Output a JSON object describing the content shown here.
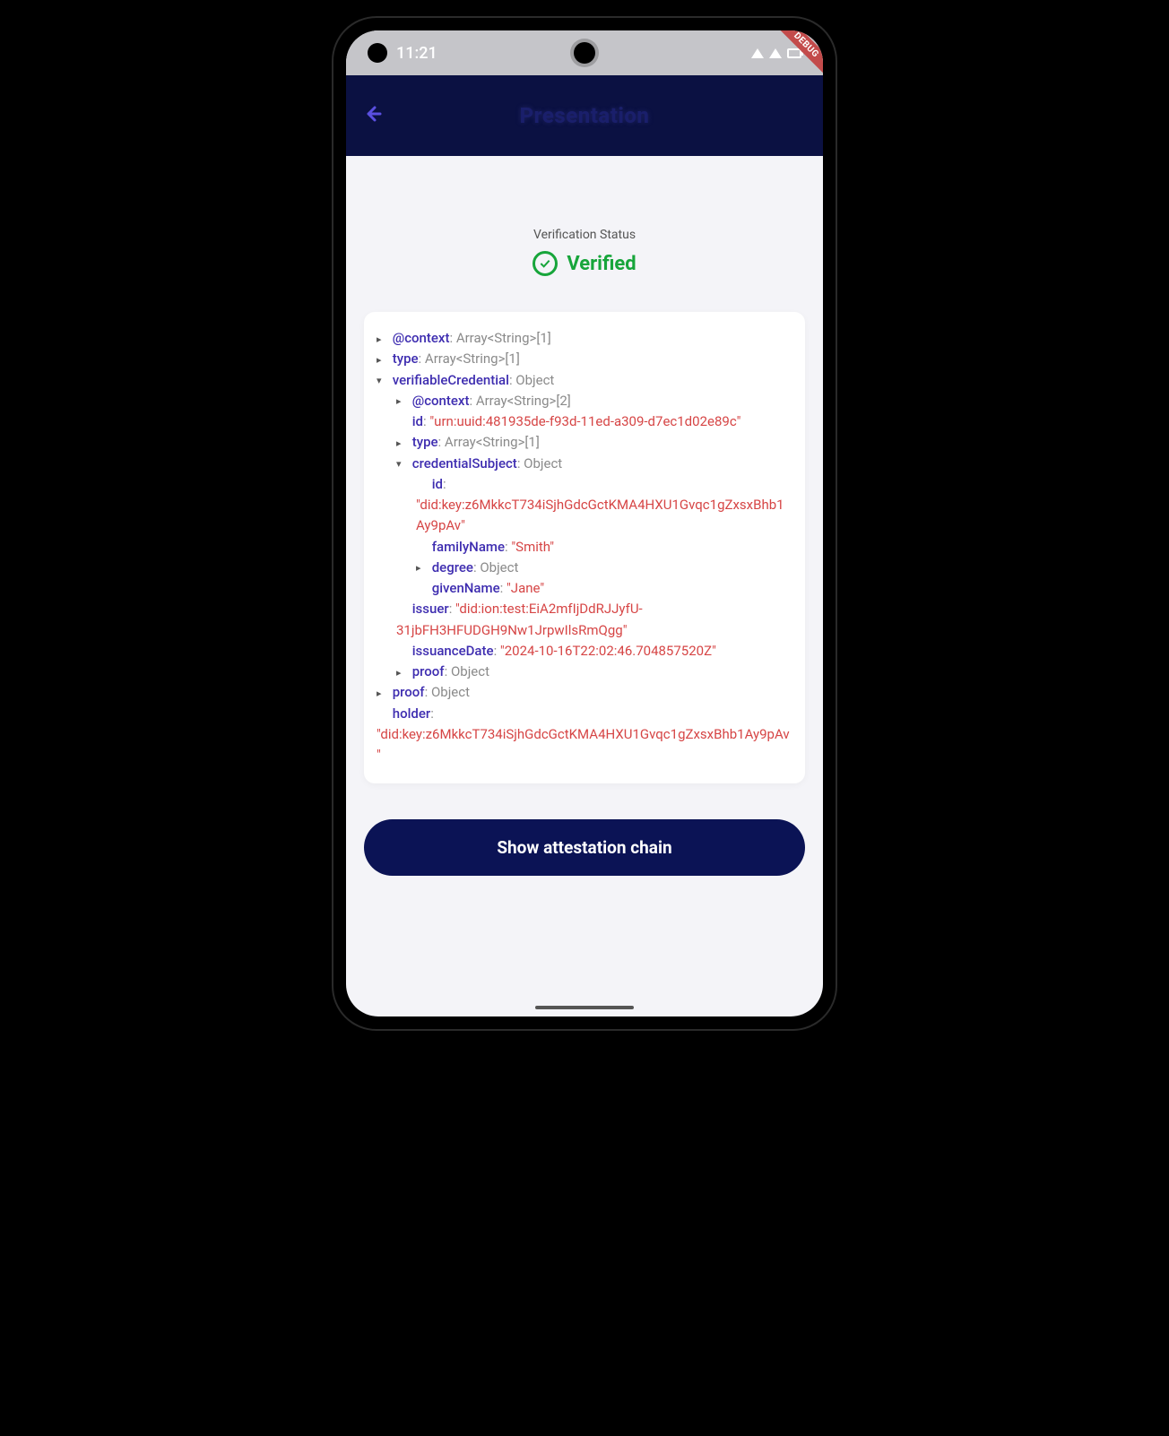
{
  "statusBar": {
    "time": "11:21"
  },
  "debugBanner": "DEBUG",
  "appBar": {
    "title": "Presentation"
  },
  "verification": {
    "label": "Verification Status",
    "status": "Verified"
  },
  "json": {
    "context_key": "@context",
    "context_type": "Array<String>[1]",
    "type_key": "type",
    "type_type": "Array<String>[1]",
    "vc_key": "verifiableCredential",
    "vc_type": "Object",
    "vc": {
      "context_key": "@context",
      "context_type": "Array<String>[2]",
      "id_key": "id",
      "id_val": "\"urn:uuid:481935de-f93d-11ed-a309-d7ec1d02e89c\"",
      "type_key": "type",
      "type_type": "Array<String>[1]",
      "cs_key": "credentialSubject",
      "cs_type": "Object",
      "cs": {
        "id_key": "id",
        "id_val": "\"did:key:z6MkkcT734iSjhGdcGctKMA4HXU1Gvqc1gZxsxBhb1Ay9pAv\"",
        "familyName_key": "familyName",
        "familyName_val": "\"Smith\"",
        "degree_key": "degree",
        "degree_type": "Object",
        "givenName_key": "givenName",
        "givenName_val": "\"Jane\""
      },
      "issuer_key": "issuer",
      "issuer_val": "\"did:ion:test:EiA2mfIjDdRJJyfU-31jbFH3HFUDGH9Nw1JrpwIlsRmQgg\"",
      "issuanceDate_key": "issuanceDate",
      "issuanceDate_val": "\"2024-10-16T22:02:46.704857520Z\"",
      "proof_key": "proof",
      "proof_type": "Object"
    },
    "proof_key": "proof",
    "proof_type": "Object",
    "holder_key": "holder",
    "holder_val": "\"did:key:z6MkkcT734iSjhGdcGctKMA4HXU1Gvqc1gZxsxBhb1Ay9pAv\""
  },
  "cta": {
    "label": "Show attestation chain"
  }
}
